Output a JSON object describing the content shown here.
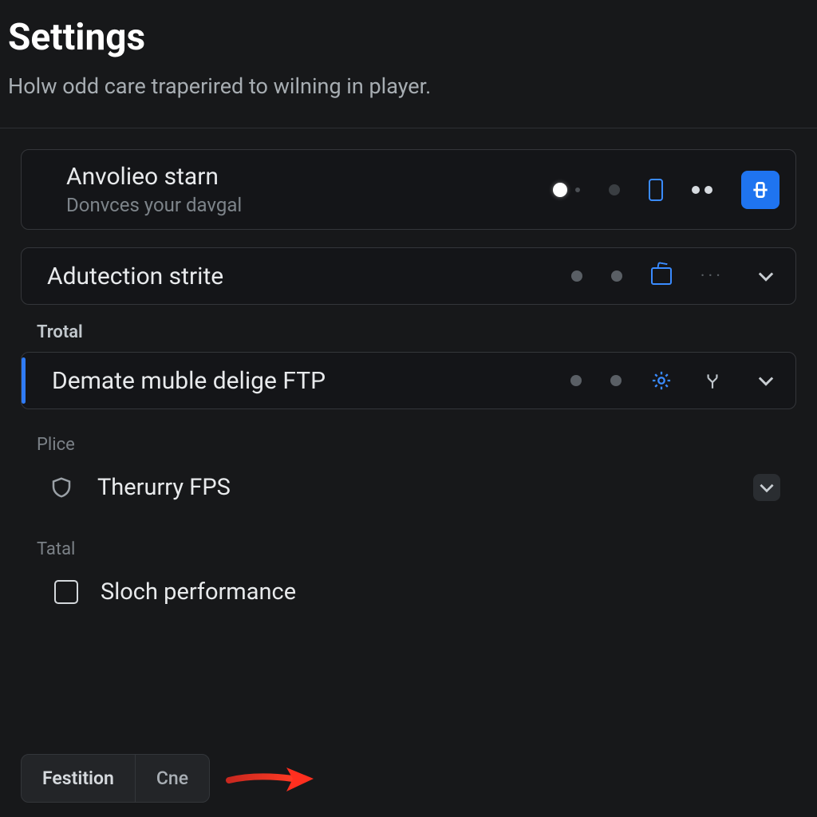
{
  "header": {
    "title": "Settings",
    "subtitle": "Holw odd care traperired to wilning in player."
  },
  "cards": {
    "anvolieo": {
      "title": "Anvolieo starn",
      "subtitle": "Donvces your davgal"
    },
    "adutection": {
      "title": "Adutection strite"
    },
    "demate": {
      "title": "Demate muble delige FTP"
    }
  },
  "sections": {
    "trotal": "Trotal",
    "plice": "Plice",
    "tatal": "Tatal"
  },
  "rows": {
    "therurry": "Therurry FPS",
    "sloch": "Sloch performance"
  },
  "bottom": {
    "festition": "Festition",
    "cne": "Cne"
  },
  "colors": {
    "accent": "#1f74f0",
    "bg": "#17181a"
  }
}
